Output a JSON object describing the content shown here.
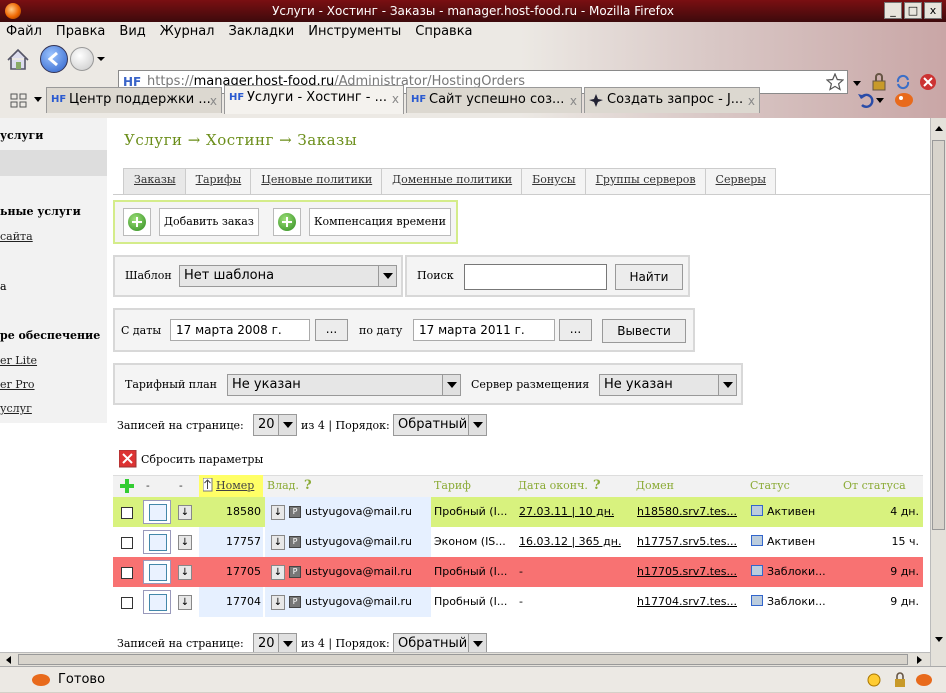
{
  "window": {
    "title": "Услуги - Хостинг - Заказы - manager.host-food.ru - Mozilla Firefox",
    "min": "_",
    "max": "□",
    "close": "x"
  },
  "menu": [
    "Файл",
    "Правка",
    "Вид",
    "Журнал",
    "Закладки",
    "Инструменты",
    "Справка"
  ],
  "url": {
    "favicon": "HF",
    "scheme": "https://",
    "host": "manager.host-food.ru",
    "path": "/Administrator/HostingOrders"
  },
  "tabs": [
    {
      "label": "Центр поддержки ...",
      "favicon": "HF",
      "active": false
    },
    {
      "label": "Услуги - Хостинг - ...",
      "favicon": "HF",
      "active": true
    },
    {
      "label": "Сайт успешно соз...",
      "favicon": "HF",
      "active": false
    },
    {
      "label": "Создать запрос - J...",
      "favicon": "",
      "active": false
    }
  ],
  "tab_close": "x",
  "sidebar": {
    "heading1": "услуги",
    "heading2": "ьные услуги",
    "link1": "сайта",
    "item1": "а",
    "heading3": "ре обеспечение",
    "link2": "er Lite",
    "link3": "er Pro",
    "link4": "услуг"
  },
  "page": {
    "title": "Услуги → Хостинг → Заказы",
    "tabs": [
      "Заказы",
      "Тарифы",
      "Ценовые политики",
      "Доменные политики",
      "Бонусы",
      "Группы серверов",
      "Серверы"
    ],
    "add_order": "Добавить заказ",
    "time_comp": "Компенсация времени",
    "template_label": "Шаблон",
    "template_value": "Нет шаблона",
    "search_label": "Поиск",
    "search_value": "",
    "search_button": "Найти",
    "date_from_label": "С даты",
    "date_from": "17 марта 2008 г.",
    "date_to_label": "по дату",
    "date_to": "17 марта 2011 г.",
    "dots": "...",
    "show_button": "Вывести",
    "plan_label": "Тарифный план",
    "plan_value": "Не указан",
    "server_label": "Сервер размещения",
    "server_value": "Не указан",
    "per_page_label": "Записей на странице:",
    "per_page": "20",
    "of_pages": "из 4 | Порядок:",
    "order": "Обратный",
    "reset": "Сбросить параметры",
    "columns": {
      "dash1": "-",
      "dash2": "-",
      "number": "Номер",
      "owner": "Влад.",
      "help": "?",
      "tariff": "Тариф",
      "enddate": "Дата оконч.",
      "domain": "Домен",
      "status": "Статус",
      "since": "От статуса"
    },
    "rows": [
      {
        "number": "18580",
        "owner": "ustyugova@mail.ru",
        "tariff": "Пробный (I...",
        "enddate": "27.03.11 | 10 дн.",
        "domain": "h18580.srv7.tes...",
        "status": "Активен",
        "since": "4 дн.",
        "bg": "#d8f27e"
      },
      {
        "number": "17757",
        "owner": "ustyugova@mail.ru",
        "tariff": "Эконом (IS...",
        "enddate": "16.03.12 | 365 дн.",
        "domain": "h17757.srv5.tes...",
        "status": "Активен",
        "since": "15 ч.",
        "bg": "#ffffff"
      },
      {
        "number": "17705",
        "owner": "ustyugova@mail.ru",
        "tariff": "Пробный (I...",
        "enddate": "-",
        "domain": "h17705.srv7.tes...",
        "status": "Заблоки...",
        "since": "9 дн.",
        "bg": "#f87272"
      },
      {
        "number": "17704",
        "owner": "ustyugova@mail.ru",
        "tariff": "Пробный (I...",
        "enddate": "-",
        "domain": "h17704.srv7.tes...",
        "status": "Заблоки...",
        "since": "9 дн.",
        "bg": "#ffffff"
      }
    ],
    "row_arrow": "↓",
    "row_pic": "P"
  },
  "status": {
    "text": "Готово"
  }
}
